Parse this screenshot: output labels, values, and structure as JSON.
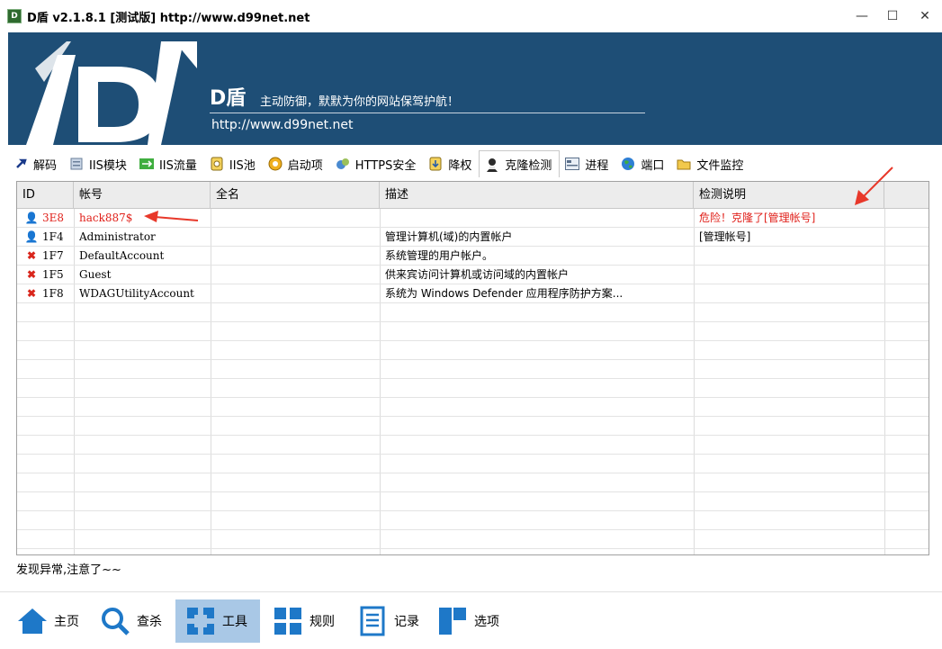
{
  "window": {
    "icon_text": "D",
    "title": "D盾 v2.1.8.1 [测试版] http://www.d99net.net",
    "min": "—",
    "max": "☐",
    "close": "✕"
  },
  "banner": {
    "brand": "D盾",
    "slogan": "主动防御，默默为你的网站保驾护航！",
    "url": "http://www.d99net.net"
  },
  "tabs": [
    {
      "label": "解码",
      "icon": "key-icon"
    },
    {
      "label": "IIS模块",
      "icon": "module-icon"
    },
    {
      "label": "IIS流量",
      "icon": "traffic-icon"
    },
    {
      "label": "IIS池",
      "icon": "pool-icon"
    },
    {
      "label": "启动项",
      "icon": "startup-icon"
    },
    {
      "label": "HTTPS安全",
      "icon": "https-icon"
    },
    {
      "label": "降权",
      "icon": "downgrade-icon"
    },
    {
      "label": "克隆检测",
      "icon": "user-clone-icon"
    },
    {
      "label": "进程",
      "icon": "process-icon"
    },
    {
      "label": "端口",
      "icon": "globe-icon"
    },
    {
      "label": "文件监控",
      "icon": "folder-icon"
    }
  ],
  "table": {
    "headers": [
      "ID",
      "帐号",
      "全名",
      "描述",
      "检测说明"
    ],
    "rows": [
      {
        "icon": "user-icon",
        "id": "3E8",
        "account": "hack887$",
        "fullname": "",
        "desc": "",
        "note": "危险！克隆了[管理帐号]",
        "danger": true
      },
      {
        "icon": "user-icon",
        "id": "1F4",
        "account": "Administrator",
        "fullname": "",
        "desc": "管理计算机(域)的内置帐户",
        "note": "[管理帐号]",
        "danger": false
      },
      {
        "icon": "x-icon",
        "id": "1F7",
        "account": "DefaultAccount",
        "fullname": "",
        "desc": "系统管理的用户帐户。",
        "note": "",
        "danger": false
      },
      {
        "icon": "x-icon",
        "id": "1F5",
        "account": "Guest",
        "fullname": "",
        "desc": "供来宾访问计算机或访问域的内置帐户",
        "note": "",
        "danger": false
      },
      {
        "icon": "x-icon",
        "id": "1F8",
        "account": "WDAGUtilityAccount",
        "fullname": "",
        "desc": "系统为 Windows Defender 应用程序防护方案...",
        "note": "",
        "danger": false
      }
    ]
  },
  "status": "发现异常,注意了~~",
  "nav": [
    {
      "label": "主页",
      "icon": "home-icon"
    },
    {
      "label": "查杀",
      "icon": "search-icon"
    },
    {
      "label": "工具",
      "icon": "tools-icon",
      "active": true
    },
    {
      "label": "规则",
      "icon": "rules-icon"
    },
    {
      "label": "记录",
      "icon": "log-icon"
    },
    {
      "label": "选项",
      "icon": "options-icon"
    }
  ],
  "colors": {
    "banner": "#1e4e76",
    "danger": "#e0201a",
    "nav_active": "#a9c8e6",
    "annotation_arrow": "#e8382a"
  }
}
